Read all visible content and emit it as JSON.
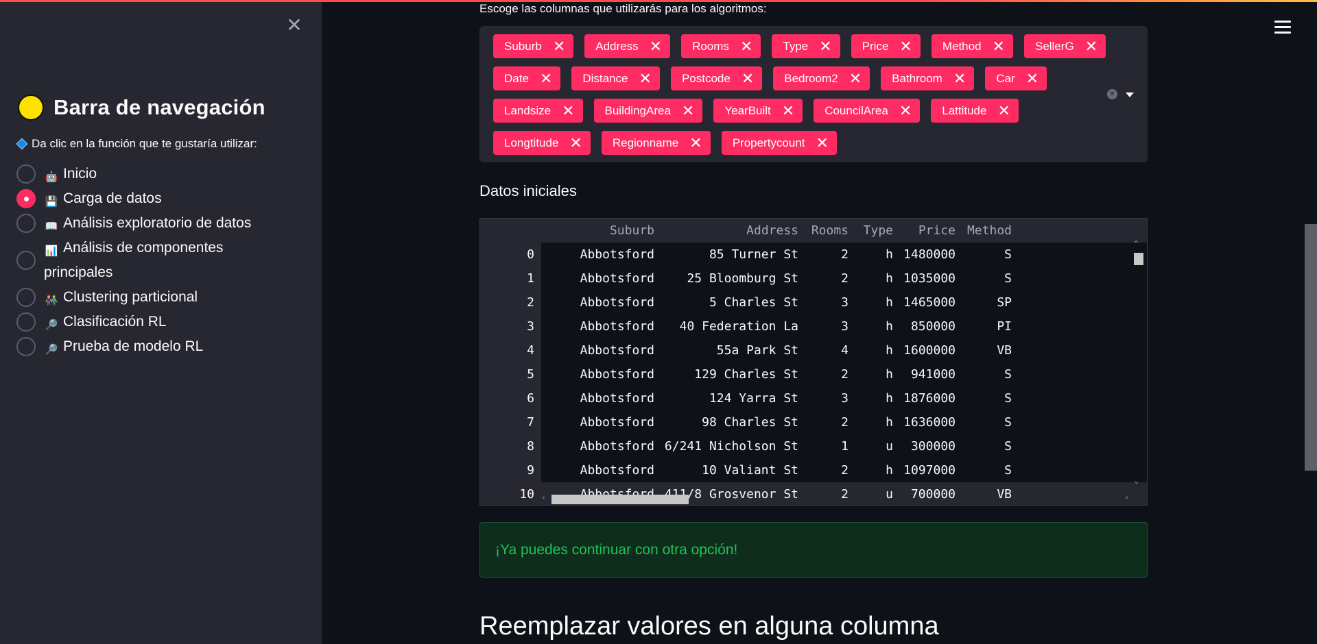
{
  "sidebar": {
    "title": "Barra de navegación",
    "subtitle": "Da clic en la función que te gustaría utilizar:",
    "items": [
      {
        "icon": "robot-icon",
        "label": "Inicio",
        "selected": false
      },
      {
        "icon": "floppy-disk-icon",
        "label": "Carga de datos",
        "selected": true
      },
      {
        "icon": "open-book-icon",
        "label": "Análisis exploratorio de datos",
        "selected": false
      },
      {
        "icon": "bar-chart-icon",
        "label": "Análisis de componentes principales",
        "selected": false
      },
      {
        "icon": "people-icon",
        "label": "Clustering particional",
        "selected": false
      },
      {
        "icon": "magnifier-icon",
        "label": "Clasificación RL",
        "selected": false
      },
      {
        "icon": "magnifier-icon",
        "label": "Prueba de modelo RL",
        "selected": false
      }
    ]
  },
  "multiselect": {
    "label": "Escoge las columnas que utilizarás para los algoritmos:",
    "tags": [
      "Suburb",
      "Address",
      "Rooms",
      "Type",
      "Price",
      "Method",
      "SellerG",
      "Date",
      "Distance",
      "Postcode",
      "Bedroom2",
      "Bathroom",
      "Car",
      "Landsize",
      "BuildingArea",
      "YearBuilt",
      "CouncilArea",
      "Lattitude",
      "Longtitude",
      "Regionname",
      "Propertycount"
    ]
  },
  "section_title": "Datos iniciales",
  "dataframe": {
    "columns": [
      "Suburb",
      "Address",
      "Rooms",
      "Type",
      "Price",
      "Method"
    ],
    "rows": [
      [
        "0",
        "Abbotsford",
        "85 Turner St",
        "2",
        "h",
        "1480000",
        "S"
      ],
      [
        "1",
        "Abbotsford",
        "25 Bloomburg St",
        "2",
        "h",
        "1035000",
        "S"
      ],
      [
        "2",
        "Abbotsford",
        "5 Charles St",
        "3",
        "h",
        "1465000",
        "SP"
      ],
      [
        "3",
        "Abbotsford",
        "40 Federation La",
        "3",
        "h",
        "850000",
        "PI"
      ],
      [
        "4",
        "Abbotsford",
        "55a Park St",
        "4",
        "h",
        "1600000",
        "VB"
      ],
      [
        "5",
        "Abbotsford",
        "129 Charles St",
        "2",
        "h",
        "941000",
        "S"
      ],
      [
        "6",
        "Abbotsford",
        "124 Yarra St",
        "3",
        "h",
        "1876000",
        "S"
      ],
      [
        "7",
        "Abbotsford",
        "98 Charles St",
        "2",
        "h",
        "1636000",
        "S"
      ],
      [
        "8",
        "Abbotsford",
        "6/241 Nicholson St",
        "1",
        "u",
        "300000",
        "S"
      ],
      [
        "9",
        "Abbotsford",
        "10 Valiant St",
        "2",
        "h",
        "1097000",
        "S"
      ],
      [
        "10",
        "Abbotsford",
        "411/8 Grosvenor St",
        "2",
        "u",
        "700000",
        "VB"
      ]
    ]
  },
  "success_message": "¡Ya puedes continuar con otra opción!",
  "next_heading": "Reemplazar valores en alguna columna",
  "colors": {
    "accent": "#ff2b63",
    "success_text": "#21c354",
    "background": "#0e1117",
    "sidebar": "#262730"
  }
}
